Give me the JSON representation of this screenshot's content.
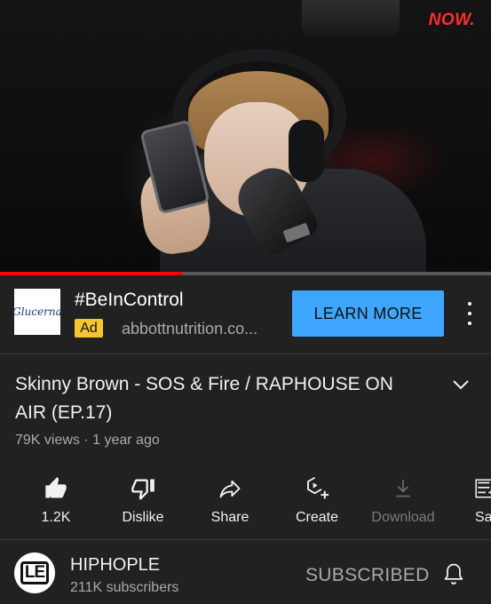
{
  "player": {
    "watermark": "NOW.",
    "progress_fraction": 0.37
  },
  "ad": {
    "logo_text": "Glucerna",
    "title": "#BeInControl",
    "badge": "Ad",
    "domain": "abbottnutrition.co...",
    "cta_label": "LEARN MORE",
    "cta_color": "#3ea6ff",
    "badge_color": "#f6c531"
  },
  "video": {
    "title": "Skinny Brown - SOS & Fire / RAPHOUSE ON AIR (EP.17)",
    "meta": "79K views · 1 year ago"
  },
  "actions": [
    {
      "icon": "thumbs-up-icon",
      "label": "1.2K"
    },
    {
      "icon": "thumbs-down-icon",
      "label": "Dislike"
    },
    {
      "icon": "share-icon",
      "label": "Share"
    },
    {
      "icon": "create-icon",
      "label": "Create"
    },
    {
      "icon": "download-icon",
      "label": "Download"
    },
    {
      "icon": "save-icon",
      "label": "Sa"
    }
  ],
  "channel": {
    "avatar_text": "LE",
    "name": "HIPHOPLE",
    "subscribers": "211K subscribers",
    "subscribe_label": "SUBSCRIBED"
  }
}
